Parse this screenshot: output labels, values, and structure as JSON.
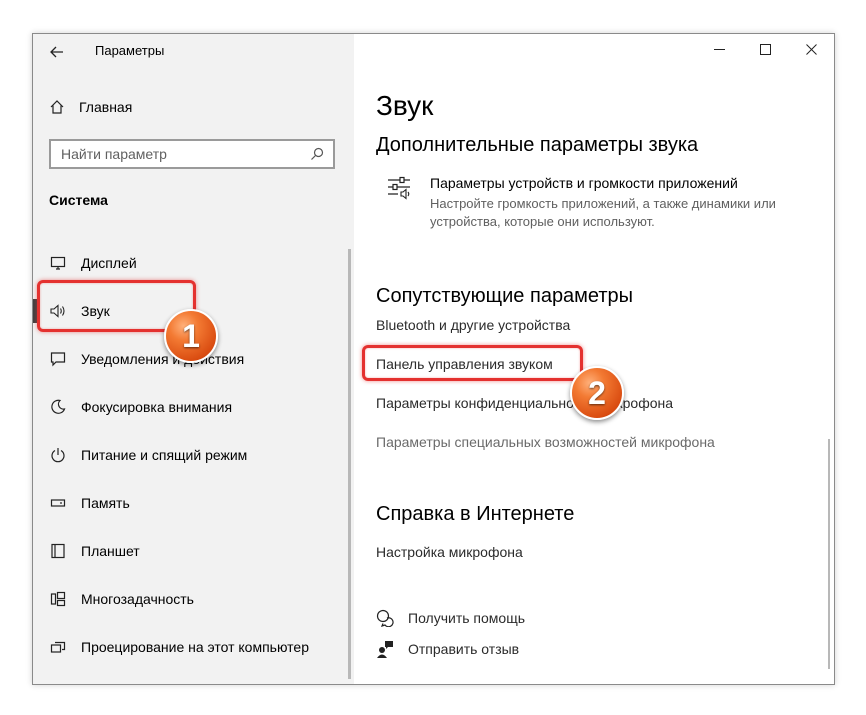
{
  "window": {
    "title": "Параметры"
  },
  "sidebar": {
    "home_label": "Главная",
    "search_placeholder": "Найти параметр",
    "section_label": "Система",
    "items": [
      {
        "label": "Дисплей",
        "icon": "monitor-icon"
      },
      {
        "label": "Звук",
        "icon": "speaker-icon",
        "selected": true
      },
      {
        "label": "Уведомления и действия",
        "icon": "notification-icon"
      },
      {
        "label": "Фокусировка внимания",
        "icon": "moon-icon"
      },
      {
        "label": "Питание и спящий режим",
        "icon": "power-icon"
      },
      {
        "label": "Память",
        "icon": "storage-icon"
      },
      {
        "label": "Планшет",
        "icon": "tablet-icon"
      },
      {
        "label": "Многозадачность",
        "icon": "multitasking-icon"
      },
      {
        "label": "Проецирование на этот компьютер",
        "icon": "projection-icon"
      }
    ]
  },
  "main": {
    "page_title": "Звук",
    "advanced": {
      "heading": "Дополнительные параметры звука",
      "item_title": "Параметры устройств и громкости приложений",
      "item_desc_1": "Настройте громкость приложений, а также динамики или",
      "item_desc_2": "устройства, которые они используют."
    },
    "related": {
      "heading": "Сопутствующие параметры",
      "links": [
        "Bluetooth и другие устройства",
        "Панель управления звуком",
        "Параметры конфиденциальности микрофона",
        "Параметры специальных возможностей микрофона"
      ]
    },
    "help": {
      "heading": "Справка в Интернете",
      "link": "Настройка микрофона",
      "get_help": "Получить помощь",
      "feedback": "Отправить отзыв"
    }
  },
  "annotations": {
    "marker1": "1",
    "marker2": "2",
    "color": "#e4312f"
  },
  "colors": {
    "sidebar_bg": "#f2f2f2",
    "text_secondary": "#606060"
  }
}
